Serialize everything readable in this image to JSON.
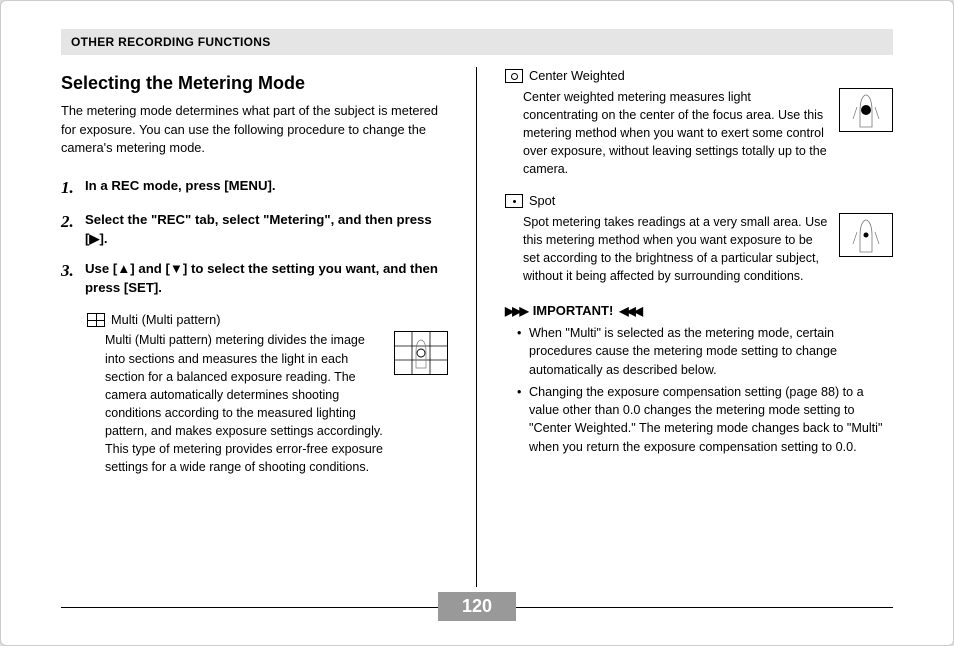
{
  "header": "OTHER RECORDING FUNCTIONS",
  "title": "Selecting the Metering Mode",
  "intro": "The metering mode determines what part of the subject is metered for exposure. You can use the following procedure to change the camera's metering mode.",
  "steps": [
    {
      "num": "1.",
      "text": "In a REC mode, press [MENU]."
    },
    {
      "num": "2.",
      "text": "Select the \"REC\" tab, select \"Metering\", and then press [▶]."
    },
    {
      "num": "3.",
      "text": "Use [▲] and [▼] to select the setting you want, and then press [SET]."
    }
  ],
  "options": {
    "multi": {
      "label": "Multi (Multi pattern)",
      "desc": "Multi (Multi pattern) metering divides the image into sections and measures the light in each section for a balanced exposure reading. The camera automatically determines shooting conditions according to the measured lighting pattern, and makes exposure settings accordingly. This type of metering provides error-free exposure settings for a wide range of shooting conditions."
    },
    "center": {
      "label": "Center Weighted",
      "desc": "Center weighted metering measures light concentrating on the center of the focus area. Use this metering method when you want to exert some control over exposure, without leaving settings totally up to the camera."
    },
    "spot": {
      "label": "Spot",
      "desc": "Spot metering takes readings at a very small area. Use this metering method when you want exposure to be set according to the brightness of a particular subject, without it being affected by surrounding conditions."
    }
  },
  "important": {
    "label": "IMPORTANT!",
    "items": [
      "When \"Multi\" is selected as the metering mode, certain procedures cause the metering mode setting to change automatically as described below.",
      "Changing the exposure compensation setting (page 88) to a value other than 0.0 changes the metering mode setting to \"Center Weighted.\" The metering mode changes back to \"Multi\" when you return the exposure compensation setting to 0.0."
    ]
  },
  "pageNumber": "120"
}
